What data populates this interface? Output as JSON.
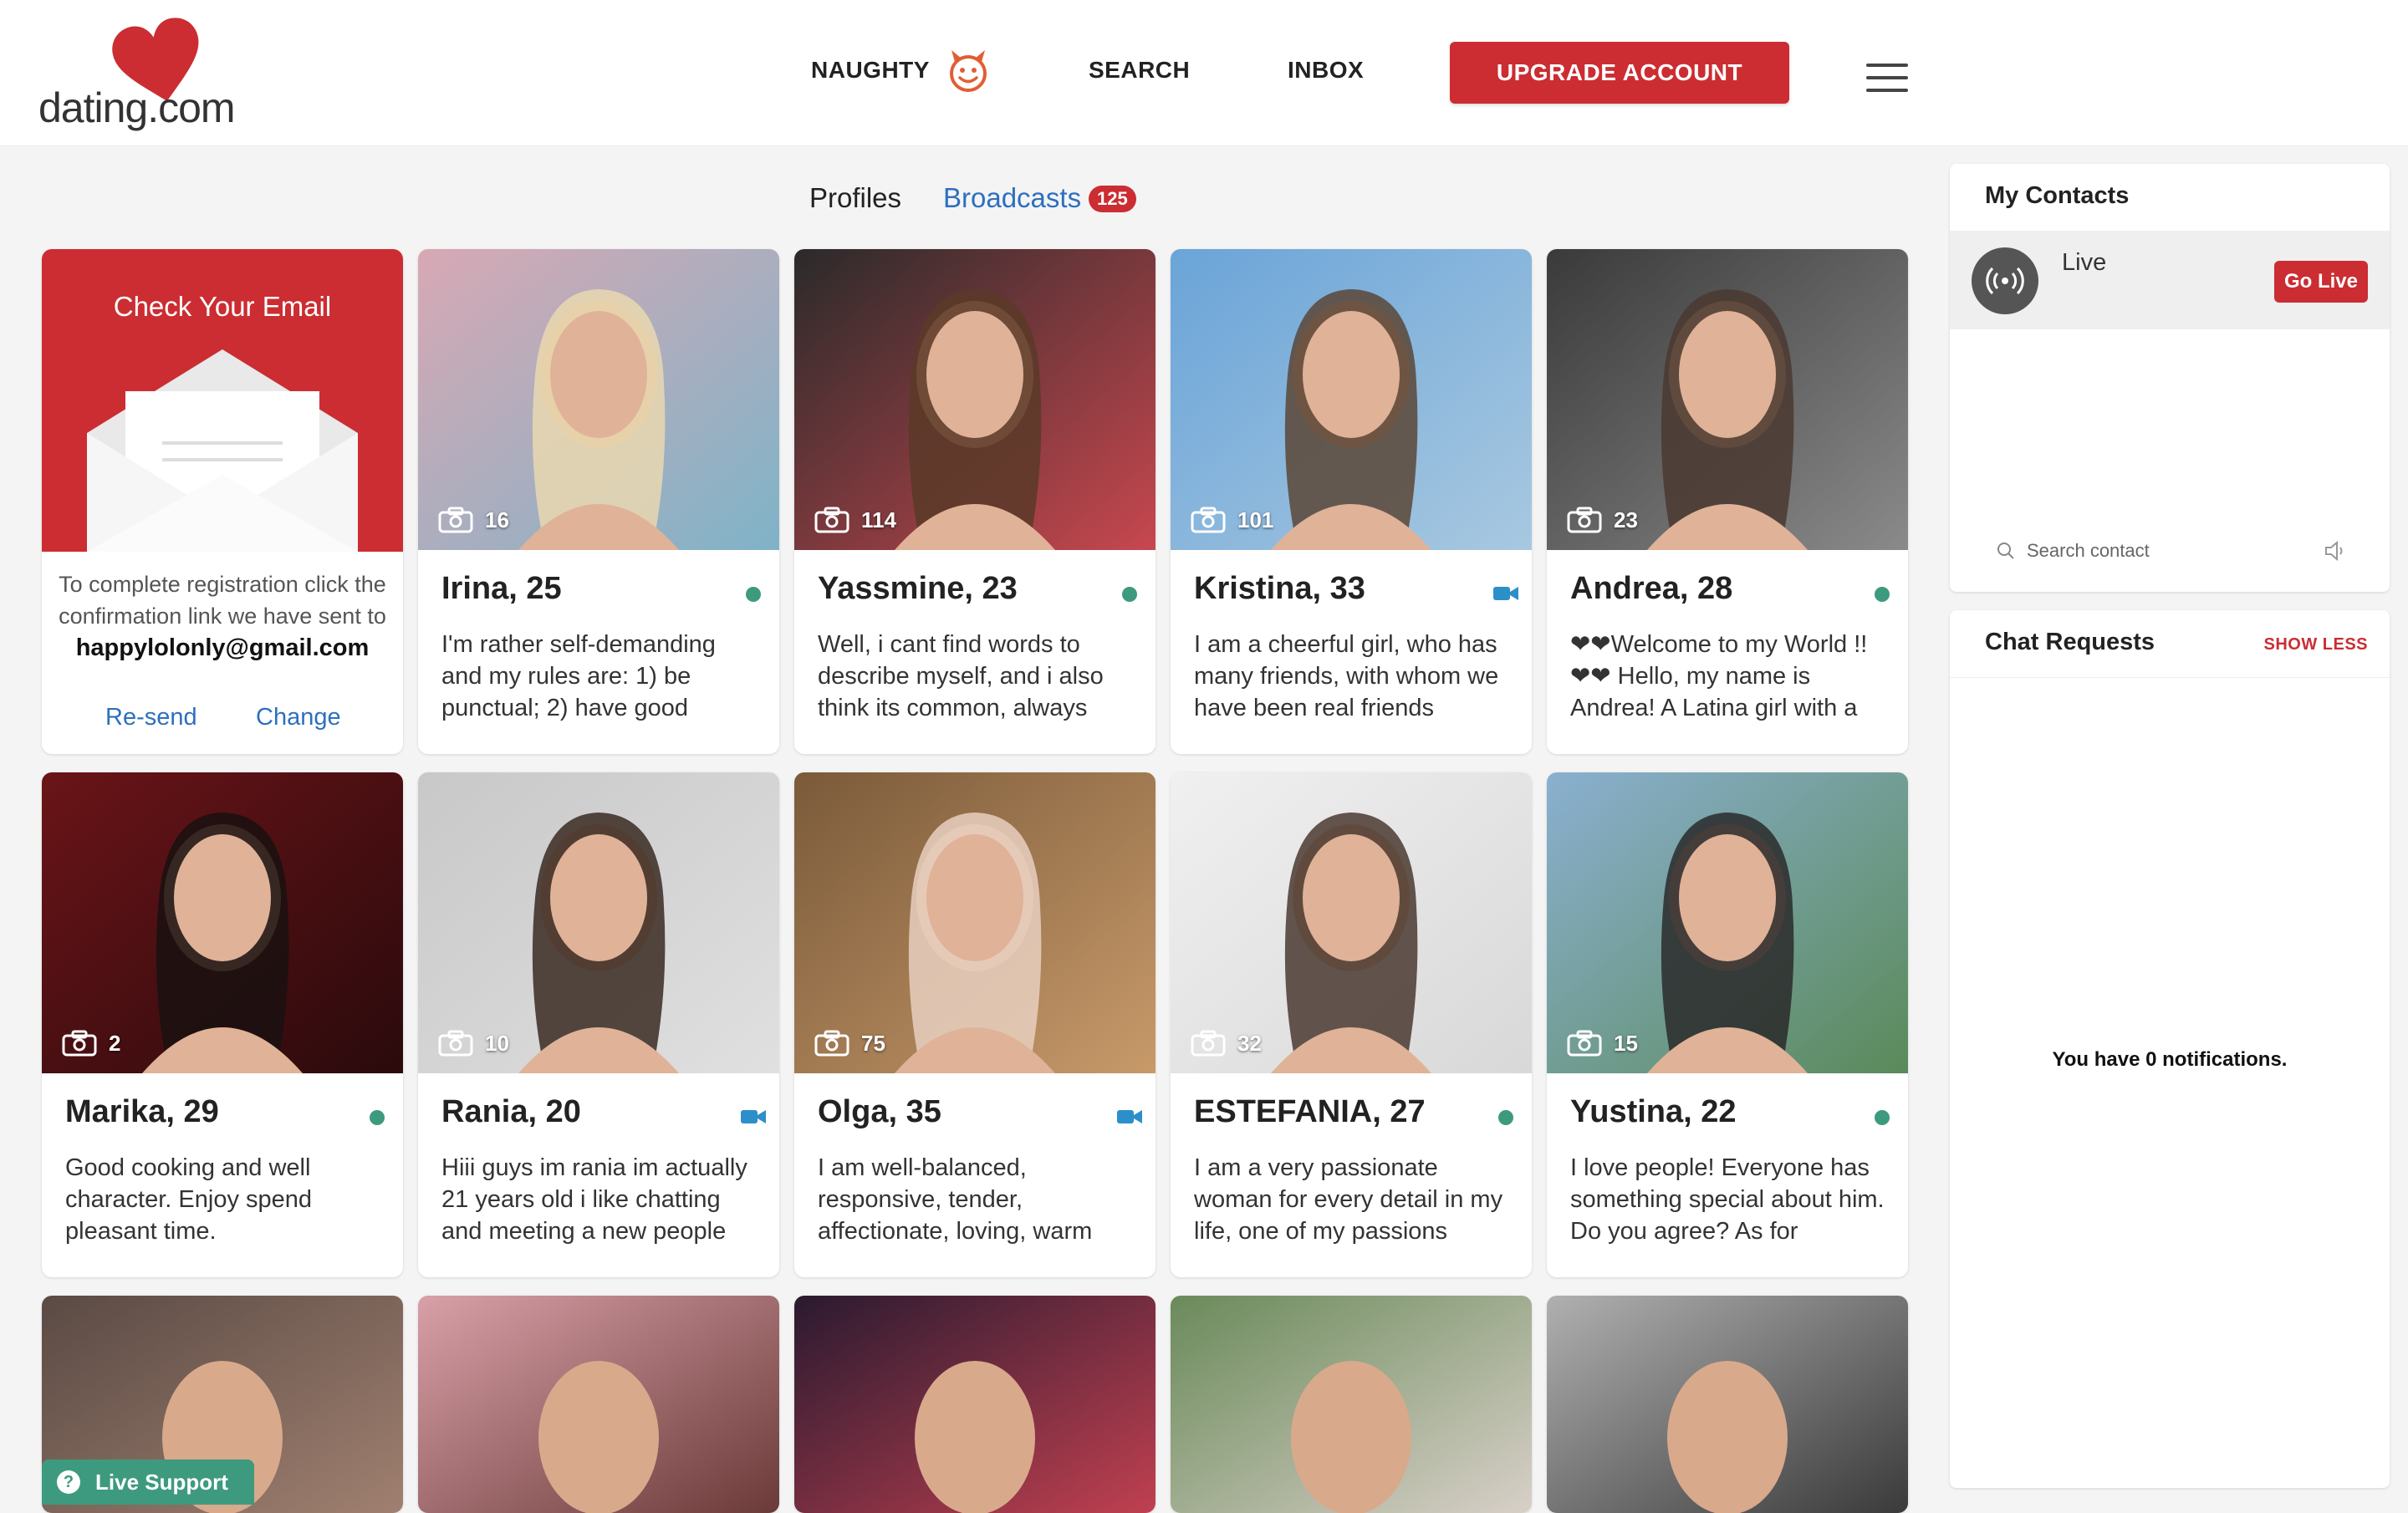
{
  "header": {
    "logo_text": "dating.com",
    "nav": {
      "naughty": "NAUGHTY",
      "search": "SEARCH",
      "inbox": "INBOX",
      "upgrade": "UPGRADE ACCOUNT"
    }
  },
  "tabs": {
    "profiles": "Profiles",
    "broadcasts": "Broadcasts",
    "broadcasts_count": "125"
  },
  "email_card": {
    "title": "Check Your Email",
    "text": "To complete registration click the confirmation link we have sent to",
    "email": "happylolonly@gmail.com",
    "resend": "Re-send",
    "change": "Change"
  },
  "profiles": [
    {
      "name": "Irina, 25",
      "photos": "16",
      "status": "online",
      "bio": "I'm rather self-demanding and my rules are: 1) be punctual; 2) have good"
    },
    {
      "name": "Yassmine, 23",
      "photos": "114",
      "status": "online",
      "bio": "Well, i cant find words to describe myself, and i also think its common, always"
    },
    {
      "name": "Kristina, 33",
      "photos": "101",
      "status": "video",
      "bio": "I am a cheerful girl, who has many friends, with whom we have been real friends"
    },
    {
      "name": "Andrea, 28",
      "photos": "23",
      "status": "online",
      "bio": "❤❤Welcome to my World !! ❤❤ Hello, my name is Andrea! A Latina girl with a"
    },
    {
      "name": "Marika, 29",
      "photos": "2",
      "status": "online",
      "bio": "Good cooking and well character. Enjoy spend pleasant time."
    },
    {
      "name": "Rania, 20",
      "photos": "10",
      "status": "video",
      "bio": "Hiii guys im rania im actually 21 years old i like chatting and meeting a new people"
    },
    {
      "name": "Olga, 35",
      "photos": "75",
      "status": "video",
      "bio": "I am well-balanced, responsive, tender, affectionate, loving, warm"
    },
    {
      "name": "ESTEFANIA, 27",
      "photos": "32",
      "status": "online",
      "bio": "I am a very passionate woman for every detail in my life, one of my passions"
    },
    {
      "name": "Yustina, 22",
      "photos": "15",
      "status": "online",
      "bio": "I love people! Everyone has something special about him. Do you agree? As for"
    }
  ],
  "contacts": {
    "title": "My Contacts",
    "live_label": "Live",
    "go_live": "Go Live",
    "search_placeholder": "Search contact"
  },
  "chat_requests": {
    "title": "Chat Requests",
    "show_less": "SHOW LESS",
    "empty": "You have 0 notifications."
  },
  "live_support": "Live Support",
  "colors": {
    "brand_red": "#cb2d32",
    "link_blue": "#2d6fbf",
    "online_green": "#3e9a7e",
    "video_blue": "#2d8fc9"
  }
}
